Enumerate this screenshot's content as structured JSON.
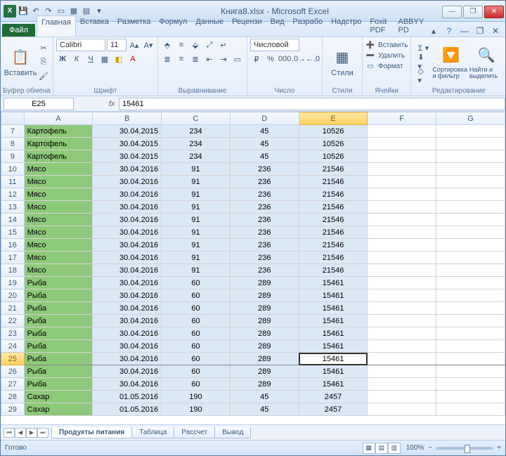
{
  "window": {
    "title": "Книга8.xlsx - Microsoft Excel"
  },
  "tabs": {
    "file": "Файл",
    "list": [
      "Главная",
      "Вставка",
      "Разметка",
      "Формул",
      "Данные",
      "Рецензи",
      "Вид",
      "Разрабо",
      "Надстро",
      "Foxit PDF",
      "ABBYY PD"
    ],
    "activeIndex": 0
  },
  "ribbon": {
    "paste": "Вставить",
    "clipboard": "Буфер обмена",
    "font_name": "Calibri",
    "font_size": "11",
    "font": "Шрифт",
    "alignment": "Выравнивание",
    "number_format": "Числовой",
    "number": "Число",
    "styles": "Стили",
    "styles_btn": "Стили",
    "cells": "Ячейки",
    "insert": "Вставить",
    "delete": "Удалить",
    "format": "Формат",
    "editing": "Редактирование",
    "sort": "Сортировка и фильтр",
    "find": "Найти и выделить"
  },
  "formula_bar": {
    "name_box": "E25",
    "formula": "15461"
  },
  "columns": [
    "A",
    "B",
    "C",
    "D",
    "E",
    "F",
    "G"
  ],
  "rows": [
    {
      "n": 7,
      "a": "Картофель",
      "b": "30.04.2015",
      "c": "234",
      "d": "45",
      "e": "10526"
    },
    {
      "n": 8,
      "a": "Картофель",
      "b": "30.04.2015",
      "c": "234",
      "d": "45",
      "e": "10526"
    },
    {
      "n": 9,
      "a": "Картофель",
      "b": "30.04.2015",
      "c": "234",
      "d": "45",
      "e": "10526"
    },
    {
      "n": 10,
      "a": "Мясо",
      "b": "30.04.2016",
      "c": "91",
      "d": "236",
      "e": "21546"
    },
    {
      "n": 11,
      "a": "Мясо",
      "b": "30.04.2016",
      "c": "91",
      "d": "236",
      "e": "21546"
    },
    {
      "n": 12,
      "a": "Мясо",
      "b": "30.04.2016",
      "c": "91",
      "d": "236",
      "e": "21546"
    },
    {
      "n": 13,
      "a": "Мясо",
      "b": "30.04.2016",
      "c": "91",
      "d": "236",
      "e": "21546"
    },
    {
      "n": 14,
      "a": "Мясо",
      "b": "30.04.2016",
      "c": "91",
      "d": "236",
      "e": "21546"
    },
    {
      "n": 15,
      "a": "Мясо",
      "b": "30.04.2016",
      "c": "91",
      "d": "236",
      "e": "21546"
    },
    {
      "n": 16,
      "a": "Мясо",
      "b": "30.04.2016",
      "c": "91",
      "d": "236",
      "e": "21546"
    },
    {
      "n": 17,
      "a": "Мясо",
      "b": "30.04.2016",
      "c": "91",
      "d": "236",
      "e": "21546"
    },
    {
      "n": 18,
      "a": "Мясо",
      "b": "30.04.2016",
      "c": "91",
      "d": "236",
      "e": "21546"
    },
    {
      "n": 19,
      "a": "Рыба",
      "b": "30.04.2016",
      "c": "60",
      "d": "289",
      "e": "15461"
    },
    {
      "n": 20,
      "a": "Рыба",
      "b": "30.04.2016",
      "c": "60",
      "d": "289",
      "e": "15461"
    },
    {
      "n": 21,
      "a": "Рыба",
      "b": "30.04.2016",
      "c": "60",
      "d": "289",
      "e": "15461"
    },
    {
      "n": 22,
      "a": "Рыба",
      "b": "30.04.2016",
      "c": "60",
      "d": "289",
      "e": "15461"
    },
    {
      "n": 23,
      "a": "Рыба",
      "b": "30.04.2016",
      "c": "60",
      "d": "289",
      "e": "15461"
    },
    {
      "n": 24,
      "a": "Рыба",
      "b": "30.04.2016",
      "c": "60",
      "d": "289",
      "e": "15461"
    },
    {
      "n": 25,
      "a": "Рыба",
      "b": "30.04.2016",
      "c": "60",
      "d": "289",
      "e": "15461",
      "active": true
    },
    {
      "n": 26,
      "a": "Рыба",
      "b": "30.04.2016",
      "c": "60",
      "d": "289",
      "e": "15461"
    },
    {
      "n": 27,
      "a": "Рыба",
      "b": "30.04.2016",
      "c": "60",
      "d": "289",
      "e": "15461"
    },
    {
      "n": 28,
      "a": "Сахар",
      "b": "01.05.2016",
      "c": "190",
      "d": "45",
      "e": "2457"
    },
    {
      "n": 29,
      "a": "Сахар",
      "b": "01.05.2016",
      "c": "190",
      "d": "45",
      "e": "2457"
    }
  ],
  "selected_column": "E",
  "selected_row": 25,
  "sheets": {
    "list": [
      "Продукты питания",
      "Таблица",
      "Рассчет",
      "Вывод"
    ],
    "activeIndex": 0
  },
  "status": {
    "ready": "Готово",
    "zoom": "100%"
  }
}
